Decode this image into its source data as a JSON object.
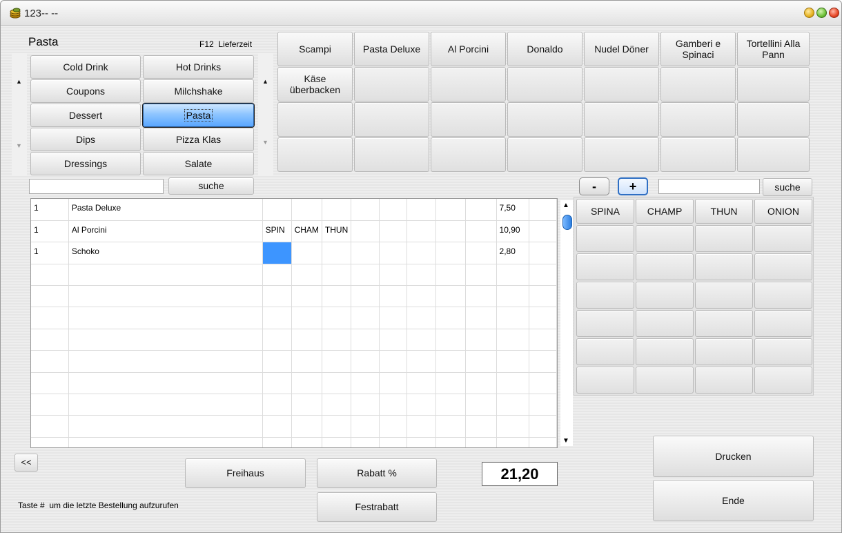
{
  "window": {
    "title": "123--   --"
  },
  "category_panel": {
    "title": "Pasta",
    "lieferzeit_key": "F12",
    "lieferzeit_label": "Lieferzeit",
    "categories": [
      "Cold Drink",
      "Hot Drinks",
      "Coupons",
      "Milchshake",
      "Dessert",
      "Pasta",
      "Dips",
      "Pizza Klas",
      "Dressings",
      "Salate"
    ],
    "selected": "Pasta"
  },
  "products": [
    "Scampi",
    "Pasta Deluxe",
    "Al Porcini",
    "Donaldo",
    "Nudel Döner",
    "Gamberi e Spinaci",
    "Tortellini Alla Pann",
    "Käse überbacken"
  ],
  "search_left": {
    "value": "",
    "button": "suche"
  },
  "search_right": {
    "value": "",
    "button": "suche"
  },
  "stepper": {
    "minus": "-",
    "plus": "+"
  },
  "order": {
    "rows": [
      {
        "qty": "1",
        "name": "Pasta Deluxe",
        "extras": [
          "",
          "",
          ""
        ],
        "price": "7,50"
      },
      {
        "qty": "1",
        "name": "Al Porcini",
        "extras": [
          "SPIN",
          "CHAM",
          "THUN"
        ],
        "price": "10,90"
      },
      {
        "qty": "1",
        "name": "Schoko",
        "extras": [
          "",
          "",
          ""
        ],
        "price": "2,80"
      }
    ]
  },
  "extras": {
    "headers": [
      "SPINA",
      "CHAMP",
      "THUN",
      "ONION"
    ]
  },
  "footer": {
    "back": "<<",
    "freihaus": "Freihaus",
    "rabatt": "Rabatt %",
    "festrabatt": "Festrabatt",
    "total": "21,20",
    "drucken": "Drucken",
    "ende": "Ende",
    "hint_key": "Taste #",
    "hint_text": "um die letzte Bestellung aufzurufen"
  }
}
